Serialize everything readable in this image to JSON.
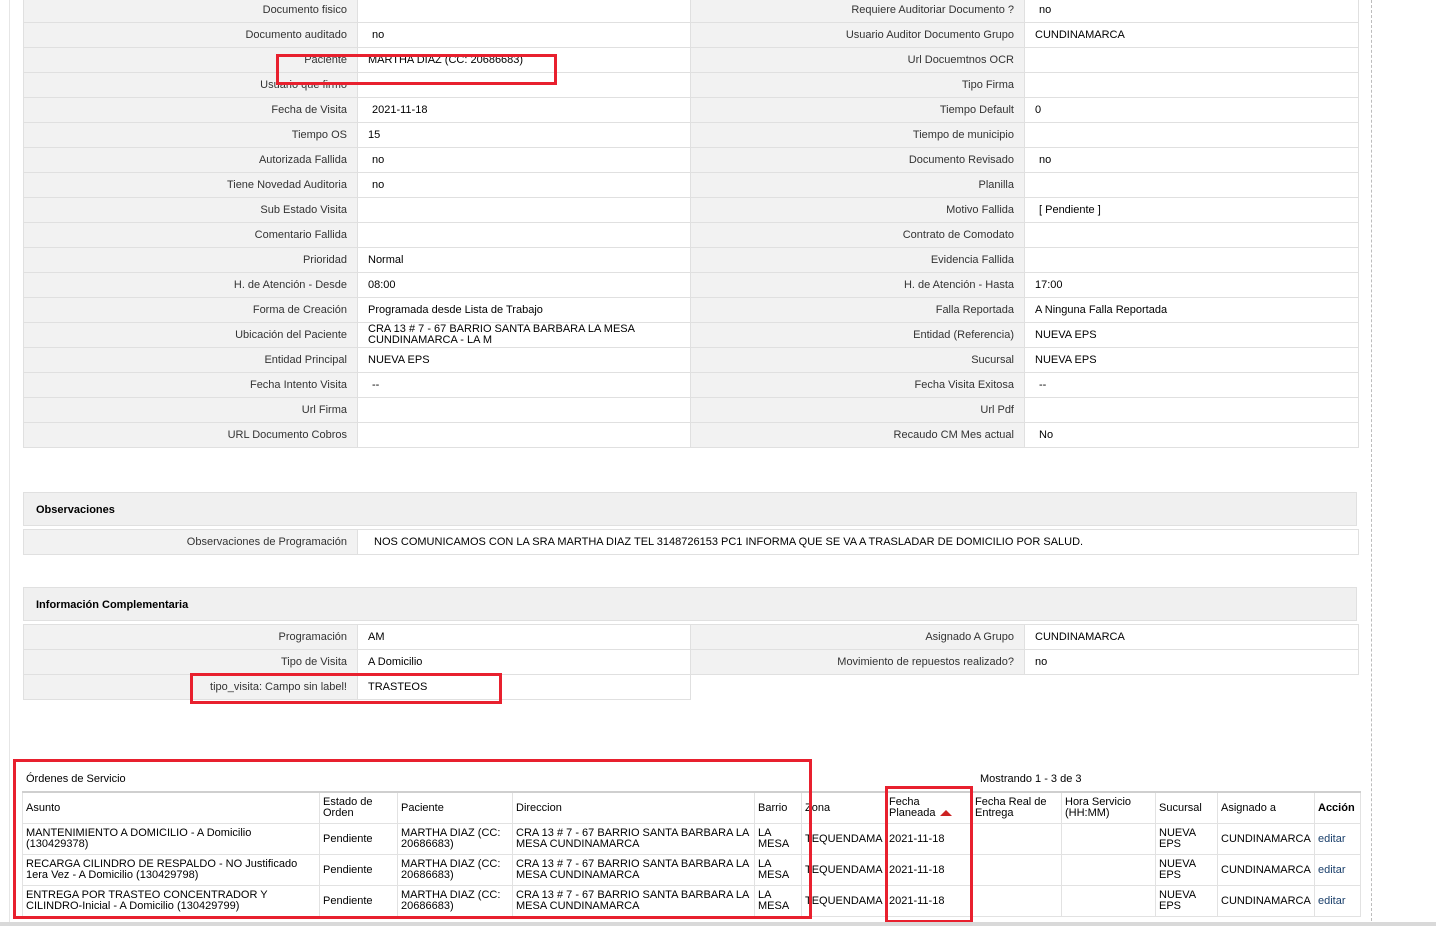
{
  "details": {
    "rows": [
      {
        "l1": "Documento fisico",
        "v1": "",
        "l2": "Requiere Auditoriar Documento ?",
        "v2": "no"
      },
      {
        "l1": "Documento auditado",
        "v1": "no",
        "l2": "Usuario Auditor Documento Grupo",
        "v2": "CUNDINAMARCA"
      },
      {
        "l1": "Paciente",
        "v1": "MARTHA DIAZ (CC: 20686683)",
        "l2": "Url Docuemtnos OCR",
        "v2": ""
      },
      {
        "l1": "Usuario que firmo",
        "v1": "",
        "l2": "Tipo Firma",
        "v2": ""
      },
      {
        "l1": "Fecha de Visita",
        "v1": "2021-11-18",
        "l2": "Tiempo Default",
        "v2": "0"
      },
      {
        "l1": "Tiempo OS",
        "v1": "15",
        "l2": "Tiempo de municipio",
        "v2": ""
      },
      {
        "l1": "Autorizada Fallida",
        "v1": "no",
        "l2": "Documento Revisado",
        "v2": "no"
      },
      {
        "l1": "Tiene Novedad Auditoria",
        "v1": "no",
        "l2": "Planilla",
        "v2": ""
      },
      {
        "l1": "Sub Estado Visita",
        "v1": "",
        "l2": "Motivo Fallida",
        "v2": "[ Pendiente ]"
      },
      {
        "l1": "Comentario Fallida",
        "v1": "",
        "l2": "Contrato de Comodato",
        "v2": ""
      },
      {
        "l1": "Prioridad",
        "v1": "Normal",
        "l2": "Evidencia Fallida",
        "v2": ""
      },
      {
        "l1": "H. de Atención - Desde",
        "v1": "08:00",
        "l2": "H. de Atención - Hasta",
        "v2": "17:00"
      },
      {
        "l1": "Forma de Creación",
        "v1": "Programada desde Lista de Trabajo",
        "l2": "Falla Reportada",
        "v2": "A Ninguna Falla Reportada"
      },
      {
        "l1": "Ubicación del Paciente",
        "v1": "CRA 13 # 7 - 67 BARRIO SANTA BARBARA LA MESA CUNDINAMARCA - LA M",
        "l2": "Entidad (Referencia)",
        "v2": "NUEVA EPS"
      },
      {
        "l1": "Entidad Principal",
        "v1": "NUEVA EPS",
        "l2": "Sucursal",
        "v2": "NUEVA EPS"
      },
      {
        "l1": "Fecha Intento Visita",
        "v1": "--",
        "l2": "Fecha Visita Exitosa",
        "v2": "--"
      },
      {
        "l1": "Url Firma",
        "v1": "",
        "l2": "Url Pdf",
        "v2": ""
      },
      {
        "l1": "URL Documento Cobros",
        "v1": "",
        "l2": "Recaudo CM Mes actual",
        "v2": "No"
      }
    ]
  },
  "observaciones": {
    "title": "Observaciones",
    "label": "Observaciones de Programación",
    "value": "NOS COMUNICAMOS CON LA SRA MARTHA DIAZ TEL 3148726153 PC1 INFORMA QUE SE VA A TRASLADAR DE DOMICILIO POR SALUD."
  },
  "complementaria": {
    "title": "Información Complementaria",
    "rows": [
      {
        "l1": "Programación",
        "v1": "AM",
        "l2": "Asignado A Grupo",
        "v2": "CUNDINAMARCA"
      },
      {
        "l1": "Tipo de Visita",
        "v1": "A Domicilio",
        "l2": "Movimiento de repuestos realizado?",
        "v2": "no"
      },
      {
        "l1": "tipo_visita: Campo sin label!",
        "v1": "TRASTEOS"
      }
    ]
  },
  "orders": {
    "title": "Órdenes de Servicio",
    "count_text": "Mostrando 1 - 3 de 3",
    "headers": {
      "asunto": "Asunto",
      "estado": "Estado de Orden",
      "paciente": "Paciente",
      "direccion": "Direccion",
      "barrio": "Barrio",
      "zona": "Zona",
      "fecha_planeada": "Fecha Planeada",
      "fecha_real": "Fecha Real de Entrega",
      "hora": "Hora Servicio (HH:MM)",
      "sucursal": "Sucursal",
      "asignado": "Asignado a",
      "accion": "Acción"
    },
    "rows": [
      {
        "asunto": "MANTENIMIENTO A DOMICILIO - A Domicilio (130429378)",
        "estado": "Pendiente",
        "paciente": "MARTHA DIAZ (CC: 20686683)",
        "direccion": "CRA 13 # 7 - 67 BARRIO SANTA BARBARA LA MESA CUNDINAMARCA",
        "barrio": "LA MESA",
        "zona": "TEQUENDAMA",
        "fecha_planeada": "2021-11-18",
        "fecha_real": "",
        "hora": "",
        "sucursal": "NUEVA EPS",
        "asignado": "CUNDINAMARCA",
        "accion": "editar"
      },
      {
        "asunto": "RECARGA CILINDRO DE RESPALDO - NO Justificado 1era Vez - A Domicilio (130429798)",
        "estado": "Pendiente",
        "paciente": "MARTHA DIAZ (CC: 20686683)",
        "direccion": "CRA 13 # 7 - 67 BARRIO SANTA BARBARA LA MESA CUNDINAMARCA",
        "barrio": "LA MESA",
        "zona": "TEQUENDAMA",
        "fecha_planeada": "2021-11-18",
        "fecha_real": "",
        "hora": "",
        "sucursal": "NUEVA EPS",
        "asignado": "CUNDINAMARCA",
        "accion": "editar"
      },
      {
        "asunto": "ENTREGA POR TRASTEO CONCENTRADOR Y CILINDRO-Inicial - A Domicilio (130429799)",
        "estado": "Pendiente",
        "paciente": "MARTHA DIAZ (CC: 20686683)",
        "direccion": "CRA 13 # 7 - 67 BARRIO SANTA BARBARA LA MESA CUNDINAMARCA",
        "barrio": "LA MESA",
        "zona": "TEQUENDAMA",
        "fecha_planeada": "2021-11-18",
        "fecha_real": "",
        "hora": "",
        "sucursal": "NUEVA EPS",
        "asignado": "CUNDINAMARCA",
        "accion": "editar"
      }
    ]
  },
  "colors": {
    "highlight": "#e8202e",
    "label_bg": "#f2f2f2",
    "section_bg": "#f0f0f0",
    "link": "#1a3f6b"
  }
}
